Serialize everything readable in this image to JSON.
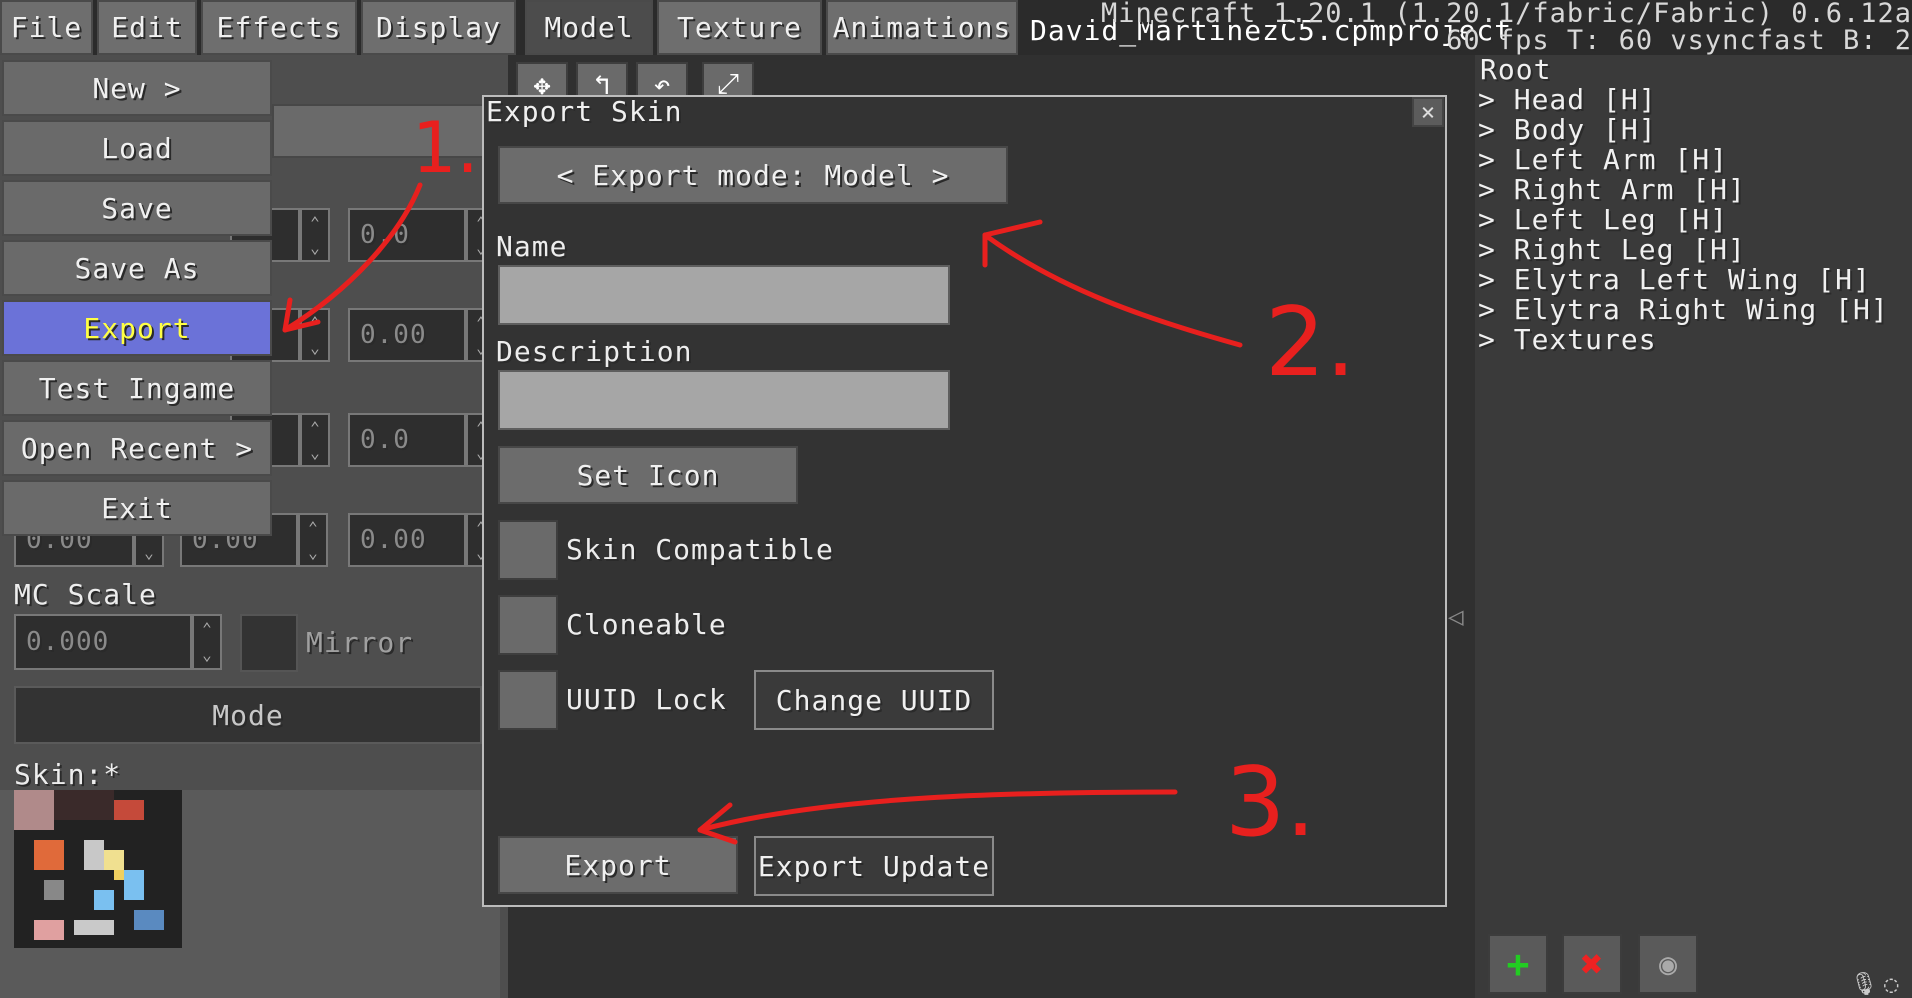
{
  "menubar": {
    "tabs": [
      {
        "label": "File"
      },
      {
        "label": "Edit"
      },
      {
        "label": "Effects"
      },
      {
        "label": "Display"
      },
      {
        "label": "Model"
      },
      {
        "label": "Texture"
      },
      {
        "label": "Animations"
      }
    ],
    "project_file": "David_MartinezC5.cpmproject",
    "mc_info_line1": "Minecraft 1.20.1 (1.20.1/fabric/Fabric) 0.6.12a",
    "mc_info_line2": "60 fps T: 60 vsyncfast B: 2"
  },
  "file_menu": {
    "items": [
      {
        "label": "New >"
      },
      {
        "label": "Load"
      },
      {
        "label": "Save"
      },
      {
        "label": "Save As"
      },
      {
        "label": "Export"
      },
      {
        "label": "Test Ingame"
      },
      {
        "label": "Open Recent >"
      },
      {
        "label": "Exit"
      }
    ],
    "highlight_color": "#6b72d8",
    "highlight_text_color": "#ffff44"
  },
  "left_panel": {
    "values": {
      "r1c2": "0.0",
      "r2c2": "0.00",
      "r3c2": "0.0",
      "r4c0": "0.00",
      "r4c1": "0.00",
      "r4c2": "0.00"
    },
    "mc_scale_label": "MC Scale",
    "mc_scale_value": "0.000",
    "mirror_label": "Mirror",
    "mode_button": "Mode",
    "skin_label": "Skin:*"
  },
  "dialog": {
    "title": "Export Skin",
    "close": "×",
    "export_mode": "< Export mode: Model >",
    "name_label": "Name",
    "name_value": "",
    "description_label": "Description",
    "description_value": "",
    "set_icon": "Set Icon",
    "skin_compatible": "Skin Compatible",
    "cloneable": "Cloneable",
    "uuid_lock": "UUID Lock",
    "change_uuid": "Change UUID",
    "export": "Export",
    "export_update": "Export Update"
  },
  "model_tree": {
    "root": "Root",
    "items": [
      {
        "label": "> Head [H]"
      },
      {
        "label": "> Body [H]"
      },
      {
        "label": "> Left Arm [H]"
      },
      {
        "label": "> Right Arm [H]"
      },
      {
        "label": "> Left Leg [H]"
      },
      {
        "label": "> Right Leg [H]"
      },
      {
        "label": "> Elytra Left Wing [H]"
      },
      {
        "label": "> Elytra Right Wing [H]"
      },
      {
        "label": "> Textures"
      }
    ]
  },
  "toolbar_icons": [
    "move-icon",
    "translate-icon",
    "rotate-icon",
    "scale-icon"
  ],
  "bottom_buttons": {
    "add": "+",
    "delete": "✖",
    "add_color": "#22cc22",
    "delete_color": "#ee2222"
  },
  "annotations": {
    "step1": "1.",
    "step2": "2.",
    "step3": "3.",
    "color": "#e8201e"
  }
}
